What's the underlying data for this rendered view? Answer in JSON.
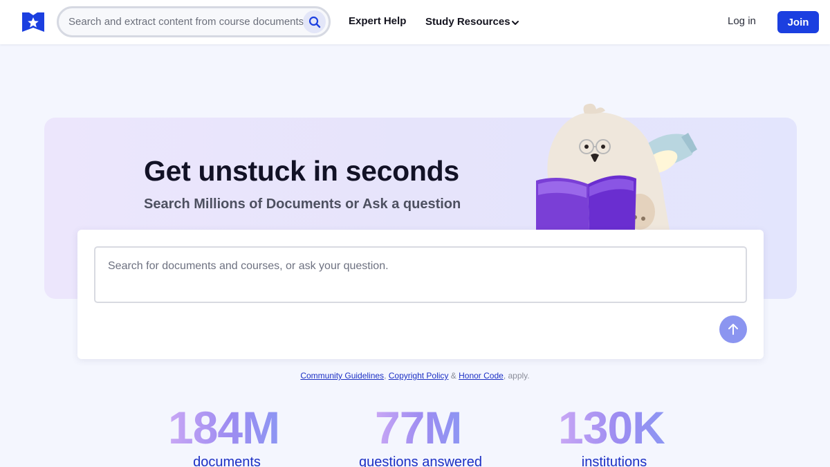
{
  "header": {
    "search_placeholder": "Search and extract content from course documents, study resources, and more",
    "nav": {
      "expert_help": "Expert Help",
      "study_resources": "Study Resources"
    },
    "login": "Log in",
    "join": "Join"
  },
  "hero": {
    "title": "Get unstuck in seconds",
    "subtitle": "Search Millions of Documents or Ask a question"
  },
  "question_box": {
    "placeholder": "Search for documents and courses, or ask your question."
  },
  "policy": {
    "link1": "Community Guidelines",
    "sep1": ", ",
    "link2": "Copyright Policy",
    "sep2": " & ",
    "link3": "Honor Code",
    "suffix": ", apply."
  },
  "stats": [
    {
      "value": "184M",
      "label": "documents"
    },
    {
      "value": "77M",
      "label": "questions answered"
    },
    {
      "value": "130K",
      "label": "institutions"
    }
  ],
  "colors": {
    "brand": "#1b3fe0",
    "link": "#1b2fc4",
    "submit_button": "#8b95f0"
  },
  "icons": {
    "logo": "shield-star-icon",
    "search": "search-icon",
    "chevron": "chevron-down-icon",
    "submit": "arrow-up-icon"
  }
}
